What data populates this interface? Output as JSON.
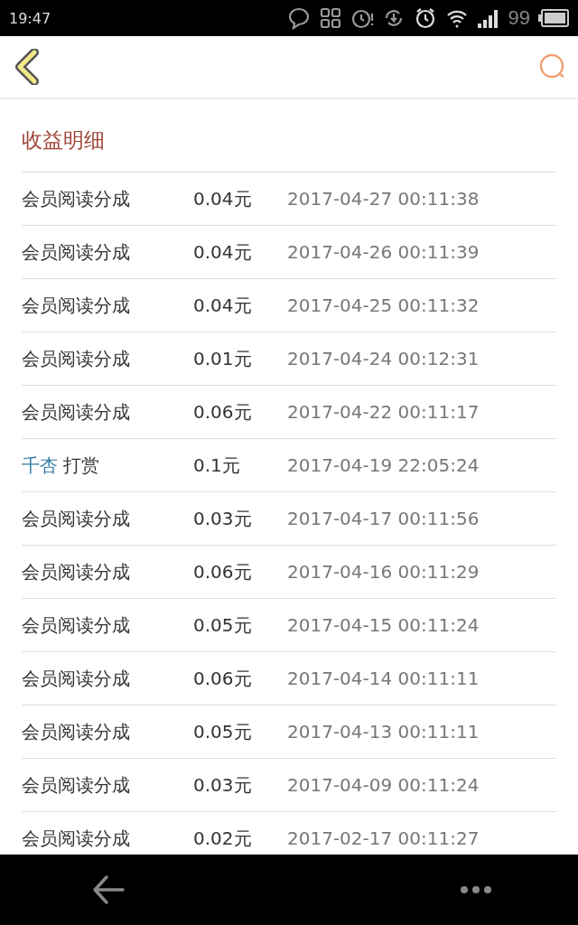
{
  "status_bar": {
    "time": "19:47",
    "battery": "99"
  },
  "section_title": "收益明细",
  "rows": [
    {
      "kind": "income",
      "label": "会员阅读分成",
      "amount": "0.04元",
      "time": "2017-04-27 00:11:38"
    },
    {
      "kind": "income",
      "label": "会员阅读分成",
      "amount": "0.04元",
      "time": "2017-04-26 00:11:39"
    },
    {
      "kind": "income",
      "label": "会员阅读分成",
      "amount": "0.04元",
      "time": "2017-04-25 00:11:32"
    },
    {
      "kind": "income",
      "label": "会员阅读分成",
      "amount": "0.01元",
      "time": "2017-04-24 00:12:31"
    },
    {
      "kind": "income",
      "label": "会员阅读分成",
      "amount": "0.06元",
      "time": "2017-04-22 00:11:17"
    },
    {
      "kind": "reward",
      "user": "千杏",
      "label": "打赏",
      "amount": "0.1元",
      "time": "2017-04-19 22:05:24"
    },
    {
      "kind": "income",
      "label": "会员阅读分成",
      "amount": "0.03元",
      "time": "2017-04-17 00:11:56"
    },
    {
      "kind": "income",
      "label": "会员阅读分成",
      "amount": "0.06元",
      "time": "2017-04-16 00:11:29"
    },
    {
      "kind": "income",
      "label": "会员阅读分成",
      "amount": "0.05元",
      "time": "2017-04-15 00:11:24"
    },
    {
      "kind": "income",
      "label": "会员阅读分成",
      "amount": "0.06元",
      "time": "2017-04-14 00:11:11"
    },
    {
      "kind": "income",
      "label": "会员阅读分成",
      "amount": "0.05元",
      "time": "2017-04-13 00:11:11"
    },
    {
      "kind": "income",
      "label": "会员阅读分成",
      "amount": "0.03元",
      "time": "2017-04-09 00:11:24"
    },
    {
      "kind": "income",
      "label": "会员阅读分成",
      "amount": "0.02元",
      "time": "2017-02-17 00:11:27"
    }
  ]
}
